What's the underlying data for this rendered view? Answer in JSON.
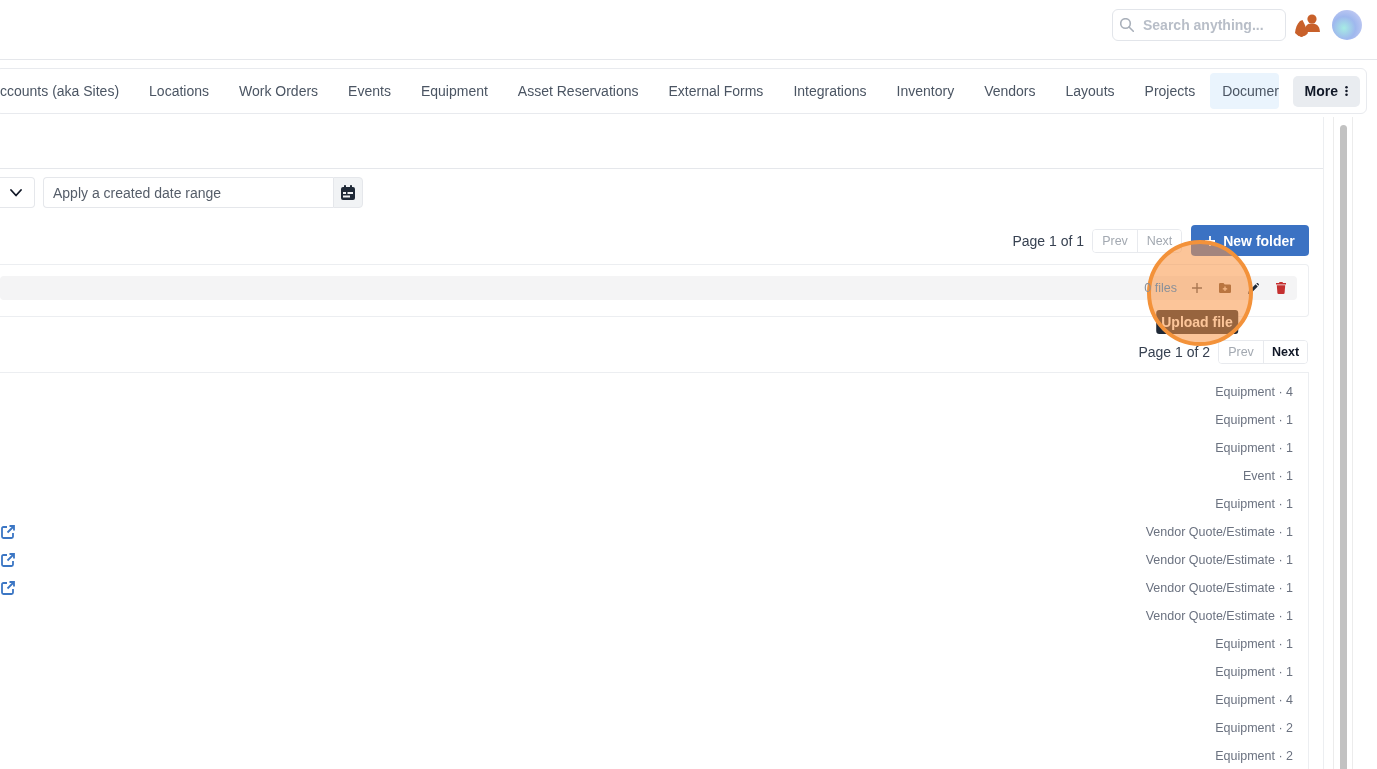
{
  "header": {
    "search": {
      "placeholder": "Search anything..."
    }
  },
  "nav": {
    "tabs": [
      {
        "label": "ccounts (aka Sites)",
        "selected": false
      },
      {
        "label": "Locations",
        "selected": false
      },
      {
        "label": "Work Orders",
        "selected": false
      },
      {
        "label": "Events",
        "selected": false
      },
      {
        "label": "Equipment",
        "selected": false
      },
      {
        "label": "Asset Reservations",
        "selected": false
      },
      {
        "label": "External Forms",
        "selected": false
      },
      {
        "label": "Integrations",
        "selected": false
      },
      {
        "label": "Inventory",
        "selected": false
      },
      {
        "label": "Vendors",
        "selected": false
      },
      {
        "label": "Layouts",
        "selected": false
      },
      {
        "label": "Projects",
        "selected": false
      },
      {
        "label": "Documer",
        "selected": true
      }
    ],
    "more_button": {
      "label": "More"
    }
  },
  "filters": {
    "date_range": {
      "placeholder": "Apply a created date range"
    }
  },
  "folders": {
    "pager": {
      "text": "Page 1 of 1",
      "prev": {
        "label": "Prev",
        "disabled": true
      },
      "next": {
        "label": "Next",
        "disabled": true
      }
    },
    "new_folder_button": {
      "label": "New folder"
    },
    "rows": [
      {
        "count": "0 files"
      }
    ],
    "tooltip": "Upload file"
  },
  "files": {
    "pager": {
      "text": "Page 1 of 2",
      "prev": {
        "label": "Prev",
        "disabled": true
      },
      "next": {
        "label": "Next",
        "disabled": false
      }
    },
    "rows": [
      {
        "tag": "Equipment · 4",
        "external_link": false
      },
      {
        "tag": "Equipment · 1",
        "external_link": false
      },
      {
        "tag": "Equipment · 1",
        "external_link": false
      },
      {
        "tag": "Event · 1",
        "external_link": false
      },
      {
        "tag": "Equipment · 1",
        "external_link": false
      },
      {
        "tag": "Vendor Quote/Estimate · 1",
        "external_link": true
      },
      {
        "tag": "Vendor Quote/Estimate · 1",
        "external_link": true
      },
      {
        "tag": "Vendor Quote/Estimate · 1",
        "external_link": true
      },
      {
        "tag": "Vendor Quote/Estimate · 1",
        "external_link": false
      },
      {
        "tag": "Equipment · 1",
        "external_link": false
      },
      {
        "tag": "Equipment · 1",
        "external_link": false
      },
      {
        "tag": "Equipment · 4",
        "external_link": false
      },
      {
        "tag": "Equipment · 2",
        "external_link": false
      },
      {
        "tag": "Equipment · 2",
        "external_link": false
      }
    ]
  }
}
